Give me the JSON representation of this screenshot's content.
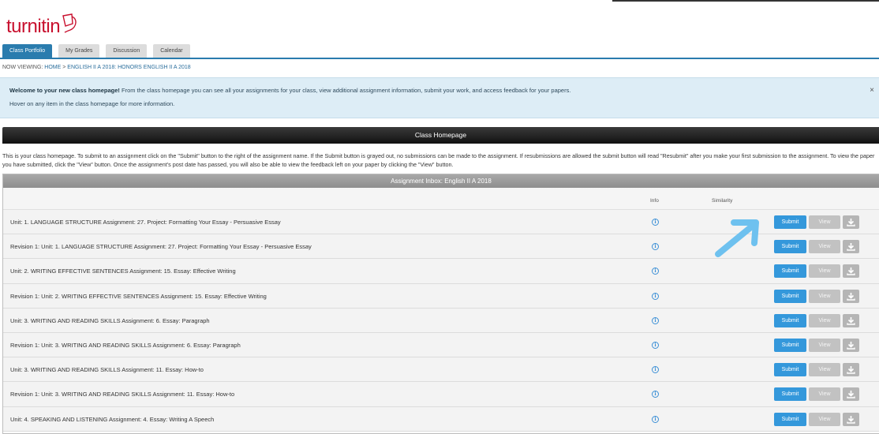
{
  "brand": {
    "logo_text": "turnitin"
  },
  "tabs": [
    {
      "label": "Class Portfolio",
      "active": true
    },
    {
      "label": "My Grades",
      "active": false
    },
    {
      "label": "Discussion",
      "active": false
    },
    {
      "label": "Calendar",
      "active": false
    }
  ],
  "breadcrumb": {
    "prefix": "NOW VIEWING:",
    "home": "HOME",
    "separator": ">",
    "course": "ENGLISH II A 2018: HONORS ENGLISH II A 2018"
  },
  "welcome": {
    "bold": "Welcome to your new class homepage!",
    "text": " From the class homepage you can see all your assignments for your class, view additional assignment information, submit your work, and access feedback for your papers.",
    "hover_text": "Hover on any item in the class homepage for more information.",
    "close": "×"
  },
  "class_homepage": {
    "title": "Class Homepage",
    "intro": "This is your class homepage. To submit to an assignment click on the \"Submit\" button to the right of the assignment name. If the Submit button is grayed out, no submissions can be made to the assignment. If resubmissions are allowed the submit button will read \"Resubmit\" after you make your first submission to the assignment. To view the paper you have submitted, click the \"View\" button. Once the assignment's post date has passed, you will also be able to view the feedback left on your paper by clicking the \"View\" button."
  },
  "inbox": {
    "title": "Assignment Inbox: English II A 2018",
    "col_info": "Info",
    "col_similarity": "Similarity",
    "submit_label": "Submit",
    "view_label": "View",
    "info_glyph": "i",
    "rows": [
      {
        "title": "Unit: 1. LANGUAGE STRUCTURE Assignment: 27. Project: Formatting Your Essay - Persuasive Essay"
      },
      {
        "title": "Revision 1: Unit: 1. LANGUAGE STRUCTURE Assignment: 27. Project: Formatting Your Essay - Persuasive Essay"
      },
      {
        "title": "Unit: 2. WRITING EFFECTIVE SENTENCES Assignment: 15. Essay: Effective Writing"
      },
      {
        "title": "Revision 1: Unit: 2. WRITING EFFECTIVE SENTENCES Assignment: 15. Essay: Effective Writing"
      },
      {
        "title": "Unit: 3. WRITING AND READING SKILLS Assignment: 6. Essay: Paragraph"
      },
      {
        "title": "Revision 1: Unit: 3. WRITING AND READING SKILLS Assignment: 6. Essay: Paragraph"
      },
      {
        "title": "Unit: 3. WRITING AND READING SKILLS Assignment: 11. Essay: How-to"
      },
      {
        "title": "Revision 1: Unit: 3. WRITING AND READING SKILLS Assignment: 11. Essay: How-to"
      },
      {
        "title": "Unit: 4. SPEAKING AND LISTENING Assignment: 4. Essay: Writing A Speech"
      }
    ]
  },
  "colors": {
    "accent": "#2a7cae",
    "submit": "#3498db",
    "brand_red": "#c8102e",
    "arrow": "#6ec1ef"
  },
  "annotation": {
    "icon": "arrow-pointing-icon"
  }
}
